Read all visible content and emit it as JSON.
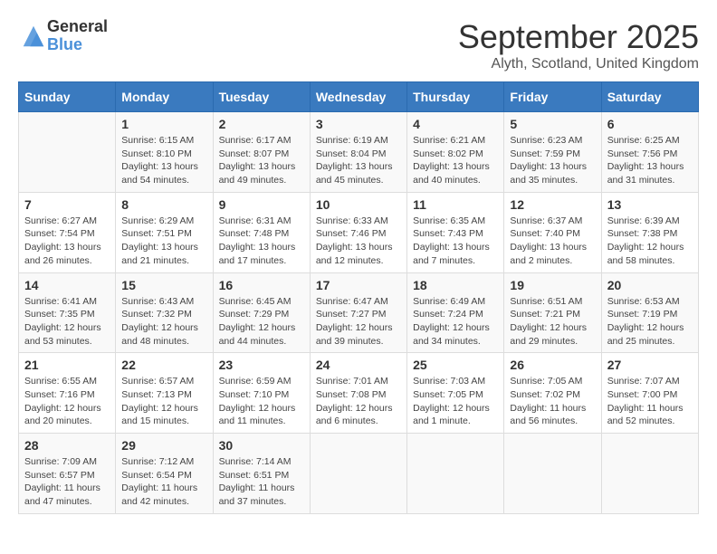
{
  "logo": {
    "general": "General",
    "blue": "Blue"
  },
  "title": "September 2025",
  "subtitle": "Alyth, Scotland, United Kingdom",
  "headers": [
    "Sunday",
    "Monday",
    "Tuesday",
    "Wednesday",
    "Thursday",
    "Friday",
    "Saturday"
  ],
  "rows": [
    [
      {
        "day": "",
        "info": ""
      },
      {
        "day": "1",
        "info": "Sunrise: 6:15 AM\nSunset: 8:10 PM\nDaylight: 13 hours\nand 54 minutes."
      },
      {
        "day": "2",
        "info": "Sunrise: 6:17 AM\nSunset: 8:07 PM\nDaylight: 13 hours\nand 49 minutes."
      },
      {
        "day": "3",
        "info": "Sunrise: 6:19 AM\nSunset: 8:04 PM\nDaylight: 13 hours\nand 45 minutes."
      },
      {
        "day": "4",
        "info": "Sunrise: 6:21 AM\nSunset: 8:02 PM\nDaylight: 13 hours\nand 40 minutes."
      },
      {
        "day": "5",
        "info": "Sunrise: 6:23 AM\nSunset: 7:59 PM\nDaylight: 13 hours\nand 35 minutes."
      },
      {
        "day": "6",
        "info": "Sunrise: 6:25 AM\nSunset: 7:56 PM\nDaylight: 13 hours\nand 31 minutes."
      }
    ],
    [
      {
        "day": "7",
        "info": "Sunrise: 6:27 AM\nSunset: 7:54 PM\nDaylight: 13 hours\nand 26 minutes."
      },
      {
        "day": "8",
        "info": "Sunrise: 6:29 AM\nSunset: 7:51 PM\nDaylight: 13 hours\nand 21 minutes."
      },
      {
        "day": "9",
        "info": "Sunrise: 6:31 AM\nSunset: 7:48 PM\nDaylight: 13 hours\nand 17 minutes."
      },
      {
        "day": "10",
        "info": "Sunrise: 6:33 AM\nSunset: 7:46 PM\nDaylight: 13 hours\nand 12 minutes."
      },
      {
        "day": "11",
        "info": "Sunrise: 6:35 AM\nSunset: 7:43 PM\nDaylight: 13 hours\nand 7 minutes."
      },
      {
        "day": "12",
        "info": "Sunrise: 6:37 AM\nSunset: 7:40 PM\nDaylight: 13 hours\nand 2 minutes."
      },
      {
        "day": "13",
        "info": "Sunrise: 6:39 AM\nSunset: 7:38 PM\nDaylight: 12 hours\nand 58 minutes."
      }
    ],
    [
      {
        "day": "14",
        "info": "Sunrise: 6:41 AM\nSunset: 7:35 PM\nDaylight: 12 hours\nand 53 minutes."
      },
      {
        "day": "15",
        "info": "Sunrise: 6:43 AM\nSunset: 7:32 PM\nDaylight: 12 hours\nand 48 minutes."
      },
      {
        "day": "16",
        "info": "Sunrise: 6:45 AM\nSunset: 7:29 PM\nDaylight: 12 hours\nand 44 minutes."
      },
      {
        "day": "17",
        "info": "Sunrise: 6:47 AM\nSunset: 7:27 PM\nDaylight: 12 hours\nand 39 minutes."
      },
      {
        "day": "18",
        "info": "Sunrise: 6:49 AM\nSunset: 7:24 PM\nDaylight: 12 hours\nand 34 minutes."
      },
      {
        "day": "19",
        "info": "Sunrise: 6:51 AM\nSunset: 7:21 PM\nDaylight: 12 hours\nand 29 minutes."
      },
      {
        "day": "20",
        "info": "Sunrise: 6:53 AM\nSunset: 7:19 PM\nDaylight: 12 hours\nand 25 minutes."
      }
    ],
    [
      {
        "day": "21",
        "info": "Sunrise: 6:55 AM\nSunset: 7:16 PM\nDaylight: 12 hours\nand 20 minutes."
      },
      {
        "day": "22",
        "info": "Sunrise: 6:57 AM\nSunset: 7:13 PM\nDaylight: 12 hours\nand 15 minutes."
      },
      {
        "day": "23",
        "info": "Sunrise: 6:59 AM\nSunset: 7:10 PM\nDaylight: 12 hours\nand 11 minutes."
      },
      {
        "day": "24",
        "info": "Sunrise: 7:01 AM\nSunset: 7:08 PM\nDaylight: 12 hours\nand 6 minutes."
      },
      {
        "day": "25",
        "info": "Sunrise: 7:03 AM\nSunset: 7:05 PM\nDaylight: 12 hours\nand 1 minute."
      },
      {
        "day": "26",
        "info": "Sunrise: 7:05 AM\nSunset: 7:02 PM\nDaylight: 11 hours\nand 56 minutes."
      },
      {
        "day": "27",
        "info": "Sunrise: 7:07 AM\nSunset: 7:00 PM\nDaylight: 11 hours\nand 52 minutes."
      }
    ],
    [
      {
        "day": "28",
        "info": "Sunrise: 7:09 AM\nSunset: 6:57 PM\nDaylight: 11 hours\nand 47 minutes."
      },
      {
        "day": "29",
        "info": "Sunrise: 7:12 AM\nSunset: 6:54 PM\nDaylight: 11 hours\nand 42 minutes."
      },
      {
        "day": "30",
        "info": "Sunrise: 7:14 AM\nSunset: 6:51 PM\nDaylight: 11 hours\nand 37 minutes."
      },
      {
        "day": "",
        "info": ""
      },
      {
        "day": "",
        "info": ""
      },
      {
        "day": "",
        "info": ""
      },
      {
        "day": "",
        "info": ""
      }
    ]
  ]
}
